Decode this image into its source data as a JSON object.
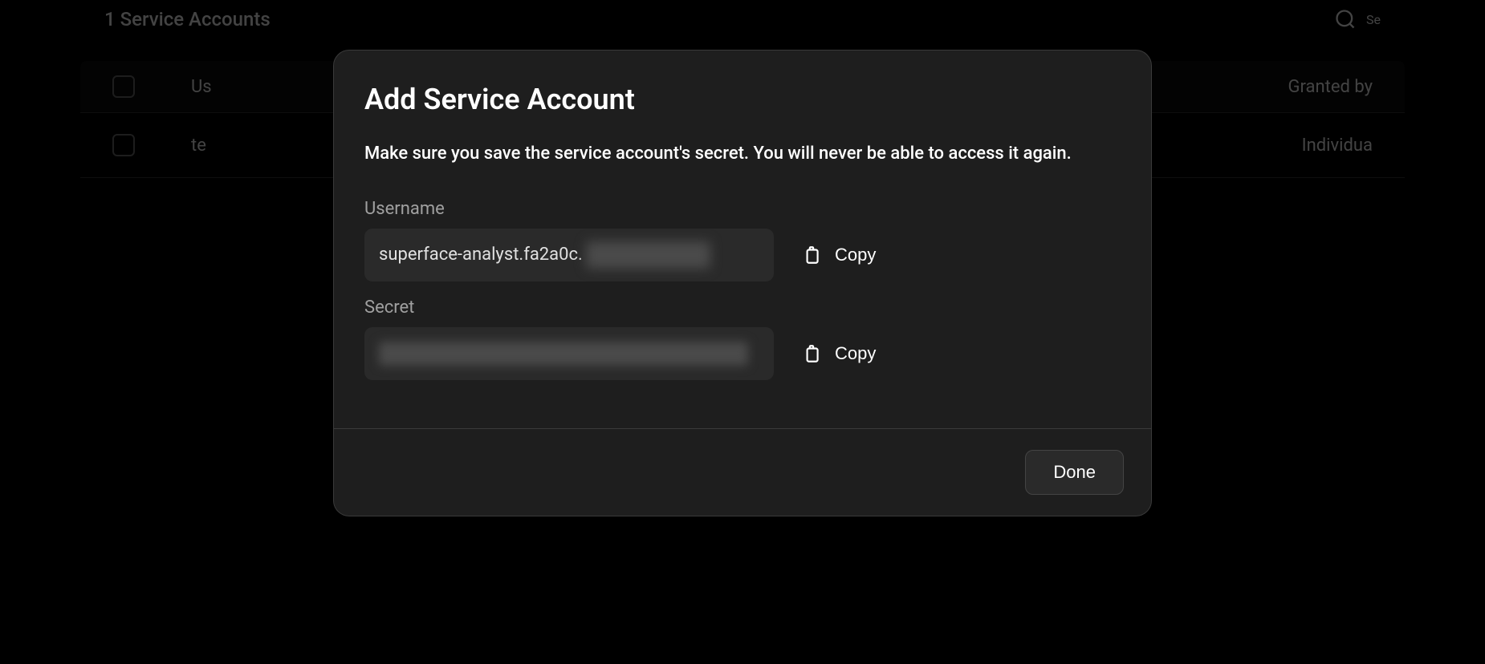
{
  "background": {
    "page_title": "1 Service Accounts",
    "search_placeholder": "Se",
    "table": {
      "header_user": "Us",
      "header_granted": "Granted by",
      "row_user": "te",
      "row_granted": "Individua"
    }
  },
  "modal": {
    "title": "Add Service Account",
    "warning": "Make sure you save the service account's secret. You will never be able to access it again.",
    "username_label": "Username",
    "username_value": "superface-analyst.fa2a0c.",
    "secret_label": "Secret",
    "copy_label": "Copy",
    "done_label": "Done"
  }
}
